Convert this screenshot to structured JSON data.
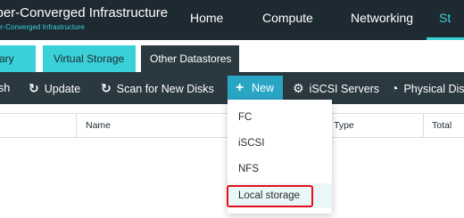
{
  "header": {
    "title": "yper-Converged Infrastructure",
    "subtitle": "yper-Converged Infrastructure",
    "nav": [
      "Home",
      "Compute",
      "Networking",
      "St"
    ],
    "active_nav": "St"
  },
  "tabs": [
    {
      "label": "ary",
      "state": "inactive"
    },
    {
      "label": "Virtual Storage",
      "state": "inactive"
    },
    {
      "label": "Other Datastores",
      "state": "active"
    }
  ],
  "toolbar": {
    "refresh_label": "sh",
    "update_label": "Update",
    "update_icon": "refresh-icon",
    "scan_label": "Scan for New Disks",
    "scan_icon": "refresh-icon",
    "new_label": "New",
    "new_icon": "plus-icon",
    "iscsi_label": "iSCSI Servers",
    "iscsi_icon": "gear-icon",
    "physical_label": "Physical Dis",
    "physical_icon": "pie-chart-icon"
  },
  "table": {
    "columns": [
      "Name",
      "Type",
      "Total"
    ]
  },
  "dropdown": {
    "items": [
      "FC",
      "iSCSI",
      "NFS",
      "Local storage"
    ],
    "highlighted": "Local storage"
  },
  "colors": {
    "header_bg": "#1e2a31",
    "accent": "#3ad0d8",
    "toolbar_bg": "#2a3840",
    "new_button": "#2aa6c5",
    "highlight_box": "#e8101a"
  }
}
